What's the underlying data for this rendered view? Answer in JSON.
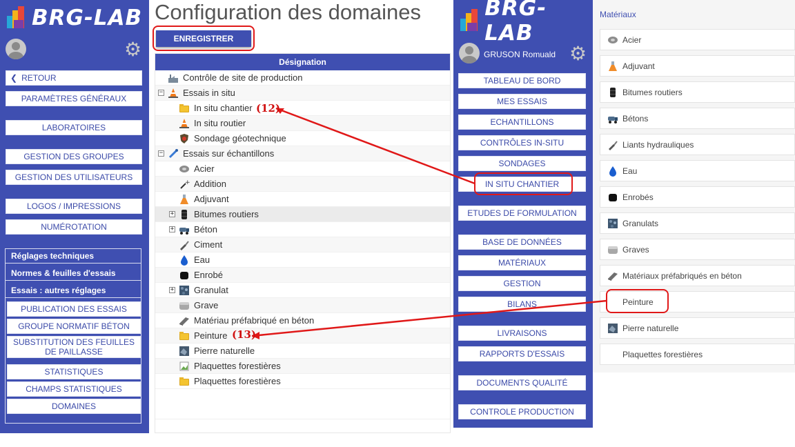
{
  "brand": {
    "name": "BRG-LAB"
  },
  "colors": {
    "primary": "#3f4fb1",
    "annotation": "#e01818"
  },
  "left_sidebar": {
    "buttons": [
      {
        "id": "retour",
        "label": "RETOUR",
        "icon": "chevron-left-icon"
      },
      {
        "id": "parametres",
        "label": "PARAMÈTRES GÉNÉRAUX"
      },
      {
        "id": "laboratoires",
        "label": "LABORATOIRES"
      },
      {
        "id": "gestion-groupes",
        "label": "GESTION DES GROUPES"
      },
      {
        "id": "gestion-utilisateurs",
        "label": "GESTION DES UTILISATEURS"
      },
      {
        "id": "logos",
        "label": "LOGOS / IMPRESSIONS"
      },
      {
        "id": "numerotation",
        "label": "NUMÉROTATION"
      }
    ],
    "tech_headers": [
      "Réglages techniques",
      "Normes & feuilles d'essais",
      "Essais : autres réglages"
    ],
    "tech_buttons": [
      {
        "label": "PUBLICATION DES ESSAIS"
      },
      {
        "label": "GROUPE NORMATIF BÉTON"
      },
      {
        "label": "SUBSTITUTION DES FEUILLES DE PAILLASSE"
      },
      {
        "label": "STATISTIQUES"
      },
      {
        "label": "CHAMPS STATISTIQUES"
      },
      {
        "label": "DOMAINES"
      }
    ]
  },
  "main": {
    "title": "Configuration des domaines",
    "save_button": "ENREGISTRER",
    "column_header": "Désignation",
    "rows": [
      {
        "label": "Contrôle de site de production",
        "level": 0,
        "icon": "factory-icon"
      },
      {
        "label": "Essais in situ",
        "level": 0,
        "icon": "cone-icon",
        "expander": "−"
      },
      {
        "label": "In situ chantier",
        "level": 1,
        "icon": "folder-icon"
      },
      {
        "label": "In situ routier",
        "level": 1,
        "icon": "cone-icon"
      },
      {
        "label": "Sondage géotechnique",
        "level": 1,
        "icon": "shield-icon"
      },
      {
        "label": "Essais sur échantillons",
        "level": 0,
        "icon": "pipette-icon",
        "expander": "−"
      },
      {
        "label": "Acier",
        "level": 1,
        "icon": "steel-icon"
      },
      {
        "label": "Addition",
        "level": 1,
        "icon": "additive-icon"
      },
      {
        "label": "Adjuvant",
        "level": 1,
        "icon": "flask-icon"
      },
      {
        "label": "Bitumes routiers",
        "level": 1,
        "icon": "barrel-icon",
        "expander": "+"
      },
      {
        "label": "Béton",
        "level": 1,
        "icon": "mixer-truck-icon",
        "expander": "+"
      },
      {
        "label": "Ciment",
        "level": 1,
        "icon": "trowel-icon"
      },
      {
        "label": "Eau",
        "level": 1,
        "icon": "drop-icon"
      },
      {
        "label": "Enrobé",
        "level": 1,
        "icon": "asphalt-icon"
      },
      {
        "label": "Granulat",
        "level": 1,
        "icon": "aggregate-icon",
        "expander": "+"
      },
      {
        "label": "Grave",
        "level": 1,
        "icon": "gravel-icon"
      },
      {
        "label": "Matériau préfabriqué en béton",
        "level": 1,
        "icon": "slab-icon"
      },
      {
        "label": "Peinture",
        "level": 1,
        "icon": "folder-icon"
      },
      {
        "label": "Pierre naturelle",
        "level": 1,
        "icon": "stone-icon"
      },
      {
        "label": "Plaquettes forestières",
        "level": 1,
        "icon": "broken-image-icon"
      },
      {
        "label": "Plaquettes forestières",
        "level": 1,
        "icon": "folder-icon"
      }
    ]
  },
  "right_sidebar": {
    "user": "GRUSON Romuald",
    "buttons": [
      {
        "label": "TABLEAU DE BORD"
      },
      {
        "label": "MES ESSAIS"
      },
      {
        "label": "ECHANTILLONS"
      },
      {
        "label": "CONTRÔLES IN-SITU"
      },
      {
        "label": "SONDAGES"
      },
      {
        "label": "IN SITU CHANTIER"
      },
      {
        "label": "ETUDES DE FORMULATION"
      },
      {
        "label": "BASE DE DONNÉES"
      },
      {
        "label": "MATÉRIAUX"
      },
      {
        "label": "GESTION"
      },
      {
        "label": "BILANS"
      },
      {
        "label": "LIVRAISONS"
      },
      {
        "label": "RAPPORTS D'ESSAIS"
      },
      {
        "label": "DOCUMENTS QUALITÉ"
      },
      {
        "label": "CONTROLE PRODUCTION"
      }
    ]
  },
  "materials_panel": {
    "title": "Matériaux",
    "items": [
      {
        "label": "Acier",
        "icon": "steel-icon"
      },
      {
        "label": "Adjuvant",
        "icon": "flask-icon"
      },
      {
        "label": "Bitumes routiers",
        "icon": "barrel-icon"
      },
      {
        "label": "Bétons",
        "icon": "mixer-truck-icon"
      },
      {
        "label": "Liants hydrauliques",
        "icon": "trowel-icon"
      },
      {
        "label": "Eau",
        "icon": "drop-icon"
      },
      {
        "label": "Enrobés",
        "icon": "asphalt-icon"
      },
      {
        "label": "Granulats",
        "icon": "aggregate-icon"
      },
      {
        "label": "Graves",
        "icon": "gravel-icon"
      },
      {
        "label": "Matériaux préfabriqués en béton",
        "icon": "slab-icon"
      },
      {
        "label": "Peinture",
        "icon": "none"
      },
      {
        "label": "Pierre naturelle",
        "icon": "stone-icon"
      },
      {
        "label": "Plaquettes forestières",
        "icon": "none"
      }
    ]
  },
  "annotations": {
    "label_12": "(12)",
    "label_13": "(13)"
  }
}
